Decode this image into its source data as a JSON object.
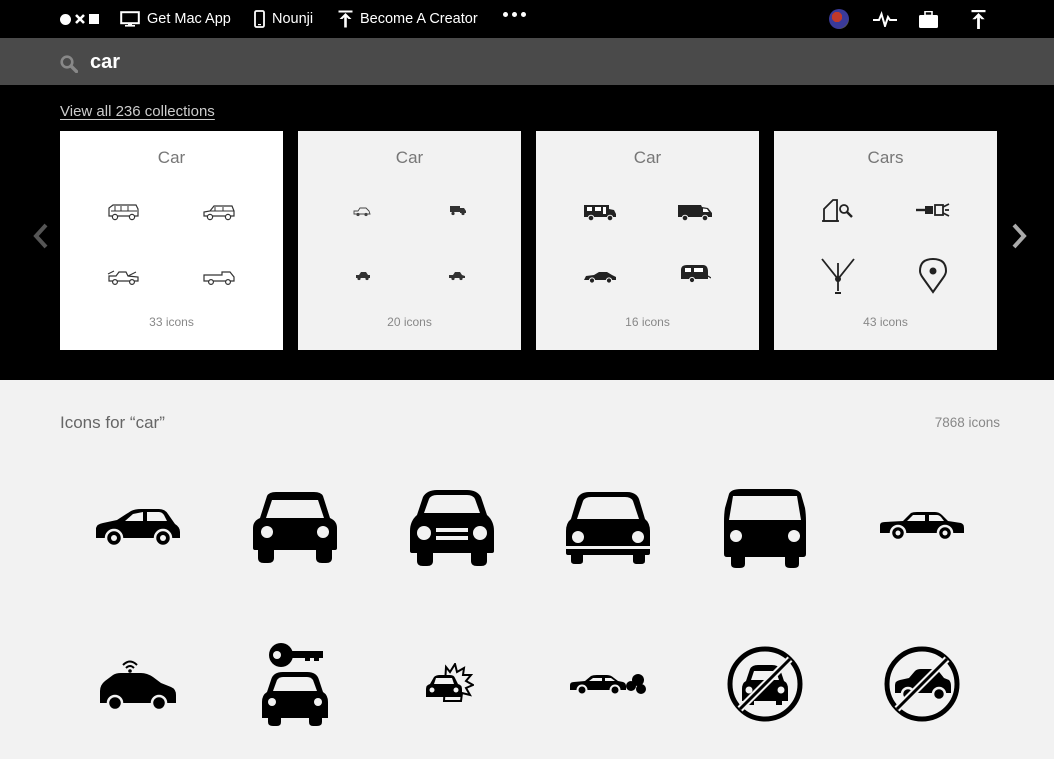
{
  "nav": {
    "get_mac_app": "Get Mac App",
    "nounji": "Nounji",
    "become_creator": "Become A Creator"
  },
  "search": {
    "value": "car",
    "placeholder": "Search"
  },
  "collections": {
    "view_all": "View all 236 collections",
    "cards": [
      {
        "title": "Car",
        "count": "33 icons"
      },
      {
        "title": "Car",
        "count": "20 icons"
      },
      {
        "title": "Car",
        "count": "16 icons"
      },
      {
        "title": "Cars",
        "count": "43 icons"
      }
    ]
  },
  "results": {
    "title": "Icons for “car”",
    "count": "7868 icons",
    "icons": [
      "hatchback-icon",
      "car-front-icon",
      "car-front-headlights-icon",
      "car-front-outline-icon",
      "van-front-icon",
      "sedan-side-icon",
      "connected-car-icon",
      "car-key-icon",
      "car-crash-icon",
      "car-exhaust-icon",
      "no-car-icon",
      "no-parking-car-icon"
    ]
  },
  "colors": {
    "nav_bg": "#000000",
    "search_bg": "#4a4a4a",
    "page_bg": "#f2f2f2"
  }
}
